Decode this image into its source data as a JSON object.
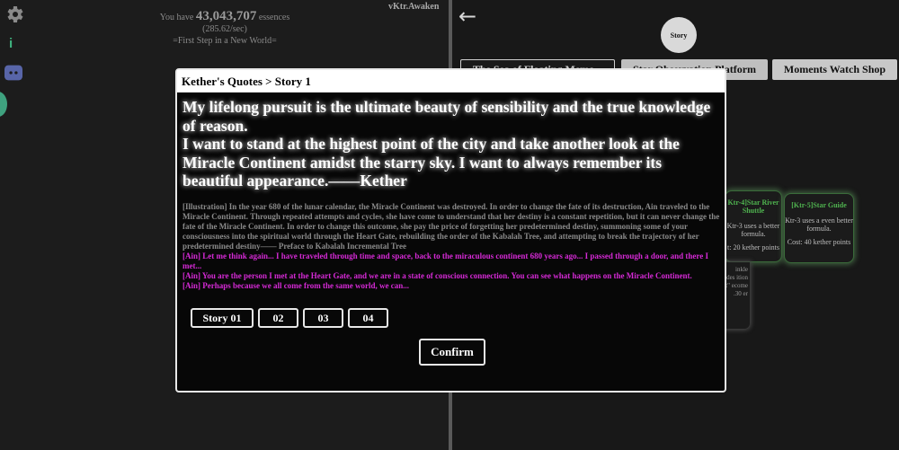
{
  "header": {
    "version": "vKtr.Awaken",
    "essence_prefix": "You have",
    "essence_value": "43,043,707",
    "essence_suffix": "essences",
    "rate": "(285.62/sec)",
    "stage": "=First Step in a New World="
  },
  "right": {
    "back_label": "←",
    "story_circle": "Story",
    "tabs": [
      "The Sea of Floating Memo...",
      "Star Observation Platform",
      "Moments Watch Shop"
    ],
    "cards": [
      {
        "title": "Ktr-4]Star River Shuttle",
        "desc": "Ktr-3 uses a better formula.",
        "cost": "t: 20 kether points"
      },
      {
        "title": "[Ktr-5]Star Guide",
        "desc": "Ktr-3 uses a even better formula.",
        "cost": "Cost: 40 kether points"
      }
    ],
    "under_card_text": "inkle rades ition t\" ecome .30 er"
  },
  "modal": {
    "title": "Kether's Quotes > Story 1",
    "quote_lines": [
      "My lifelong pursuit is the ultimate beauty of sensibility and the true knowledge of reason.",
      "I want to stand at the highest point of the city and take another look at the Miracle Continent amidst the starry sky. I want to always remember its beautiful appearance.——Kether"
    ],
    "illustration": "[Illustration] In the year 680 of the lunar calendar, the Miracle Continent was destroyed. In order to change the fate of its destruction, Ain traveled to the Miracle Continent. Through repeated attempts and cycles, she have come to understand that her destiny is a constant repetition, but it can never change the fate of the Miracle Continent. In order to change this outcome, she pay the price of forgetting her predetermined destiny, summoning some of your consciousness into the spiritual world through the Heart Gate, rebuilding the order of the Kabalah Tree, and attempting to break the trajectory of her predetermined destiny—— Preface to Kabalah Incremental Tree",
    "ain_lines": [
      "[Ain] Let me think again... I have traveled through time and space, back to the miraculous continent 680 years ago... I passed through a door, and there I met...",
      "[Ain] You are the person I met at the Heart Gate, and we are in a state of conscious connection. You can see what happens on the Miracle Continent.",
      "[Ain] Perhaps because we all come from the same world, we can..."
    ],
    "story_buttons": [
      "Story 01",
      "02",
      "03",
      "04"
    ],
    "confirm": "Confirm"
  },
  "colors": {
    "ain_text": "#d62ad6",
    "card_title": "#4fb34f",
    "info_icon": "#3fb37f"
  }
}
